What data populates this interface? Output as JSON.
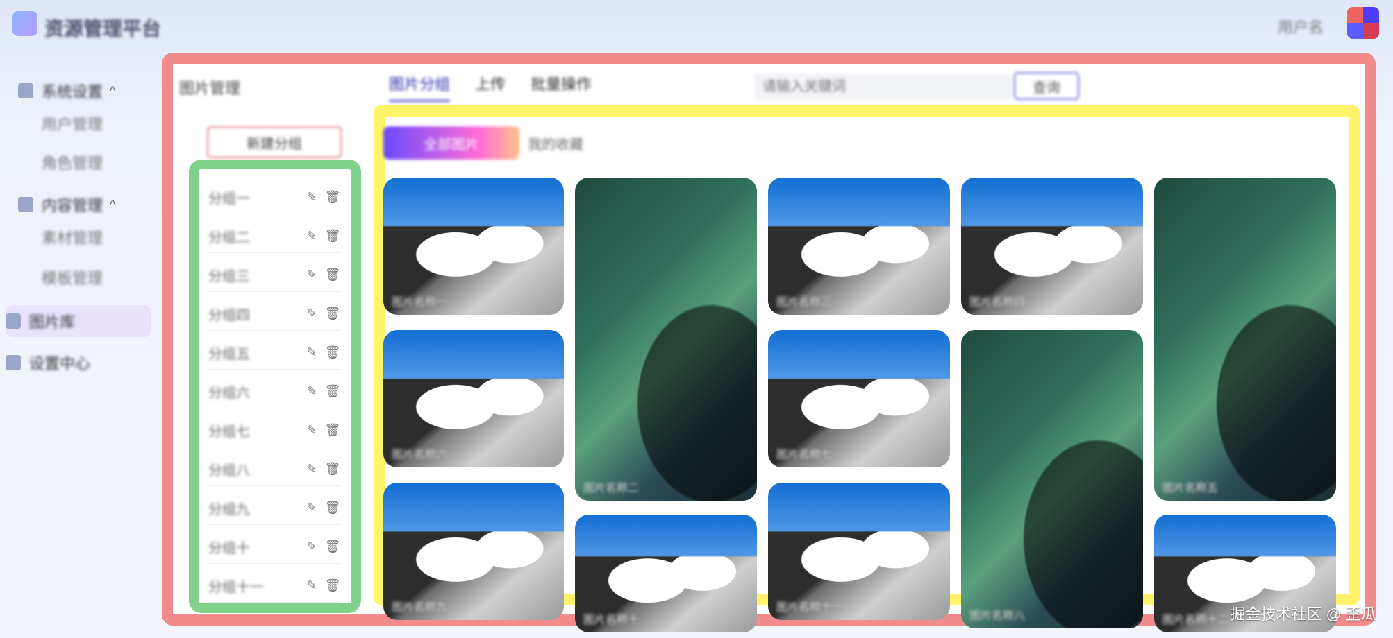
{
  "top": {
    "app_title": "资源管理平台",
    "user_name": "用户名"
  },
  "sidebar": {
    "groups": [
      {
        "label": "系统设置",
        "items": [
          "用户管理",
          "角色管理"
        ]
      },
      {
        "label": "内容管理",
        "items": [
          "素材管理",
          "模板管理"
        ]
      }
    ],
    "active_item": "图片库",
    "extra_item": "设置中心"
  },
  "main": {
    "frame_label": "图片管理",
    "tabs": [
      "图片分组",
      "上传",
      "批量操作"
    ],
    "search_placeholder": "请输入关键词",
    "search_button": "查询"
  },
  "left_panel": {
    "new_group_button": "新建分组",
    "groups": [
      "分组一",
      "分组二",
      "分组三",
      "分组四",
      "分组五",
      "分组六",
      "分组七",
      "分组八",
      "分组九",
      "分组十",
      "分组十一"
    ]
  },
  "gallery": {
    "segmented": {
      "active": "全部图片",
      "other": "我的收藏"
    },
    "tiles": [
      {
        "type": "mountain",
        "caption": "图片名称一"
      },
      {
        "type": "wave",
        "caption": "图片名称二"
      },
      {
        "type": "mountain",
        "caption": "图片名称三"
      },
      {
        "type": "mountain",
        "caption": "图片名称四"
      },
      {
        "type": "wave",
        "caption": "图片名称五"
      },
      {
        "type": "mountain",
        "caption": "图片名称六"
      },
      {
        "type": "mountain",
        "caption": "图片名称七"
      },
      {
        "type": "wave",
        "caption": "图片名称八"
      },
      {
        "type": "mountain",
        "caption": "图片名称九"
      },
      {
        "type": "mountain",
        "caption": "图片名称十"
      },
      {
        "type": "mountain",
        "caption": "图片名称十一"
      },
      {
        "type": "mountain",
        "caption": "图片名称十二"
      }
    ]
  },
  "watermark": "掘金技术社区 @ 歪瓜"
}
